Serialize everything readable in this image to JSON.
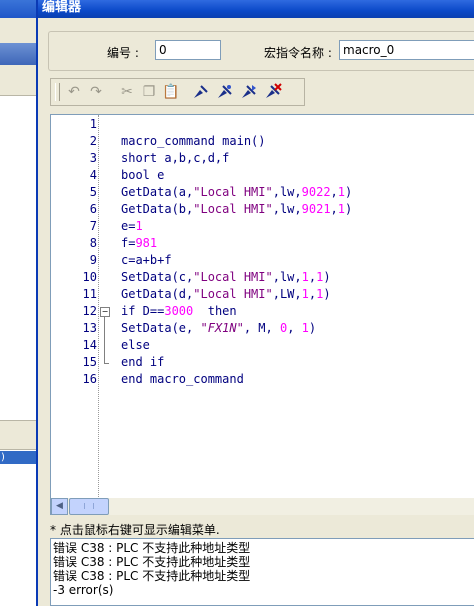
{
  "window": {
    "title": "编辑器"
  },
  "header": {
    "number_label": "编号 :",
    "number_value": "0",
    "macro_name_label": "宏指令名称 :",
    "macro_name_value": "macro_0"
  },
  "toolbar": {
    "buttons": [
      "undo-icon",
      "redo-icon",
      "cut-icon",
      "copy-icon",
      "paste-icon",
      "syntax-check-icon",
      "compile-icon",
      "run-icon",
      "delete-icon"
    ]
  },
  "code": {
    "lines": [
      {
        "n": "1",
        "html": ""
      },
      {
        "n": "2",
        "html": "macro_command main()"
      },
      {
        "n": "3",
        "html": "short a,b,c,d,f"
      },
      {
        "n": "4",
        "html": "bool e"
      },
      {
        "n": "5",
        "html": "GetData(a,\"Local HMI\",lw,9022,1)"
      },
      {
        "n": "6",
        "html": "GetData(b,\"Local HMI\",lw,9021,1)"
      },
      {
        "n": "7",
        "html": "e=1"
      },
      {
        "n": "8",
        "html": "f=981"
      },
      {
        "n": "9",
        "html": "c=a+b+f"
      },
      {
        "n": "10",
        "html": "SetData(c,\"Local HMI\",lw,1,1)"
      },
      {
        "n": "11",
        "html": "GetData(d,\"Local HMI\",LW,1,1)"
      },
      {
        "n": "12",
        "html": "if D==3000  then"
      },
      {
        "n": "13",
        "html": "SetData(e, \"FX1N\", M, 0, 1)"
      },
      {
        "n": "14",
        "html": "else"
      },
      {
        "n": "15",
        "html": "end if"
      },
      {
        "n": "16",
        "html": "end macro_command"
      }
    ]
  },
  "hint": "* 点击鼠标右键可显示编辑菜单.",
  "errors": {
    "lines": [
      "错误 C38 : PLC 不支持此种地址类型",
      "错误 C38 : PLC 不支持此种地址类型",
      "错误 C38 : PLC 不支持此种地址类型",
      " -3 error(s)"
    ]
  },
  "background_app": {
    "selected_item": ")"
  }
}
